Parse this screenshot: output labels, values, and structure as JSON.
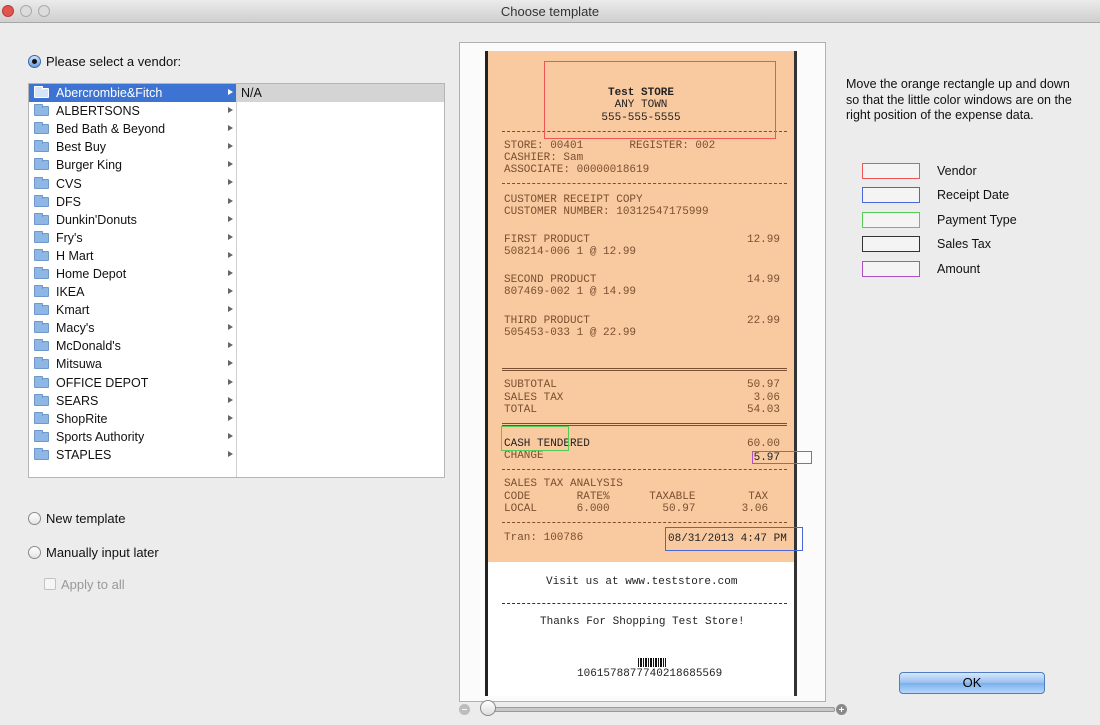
{
  "window": {
    "title": "Choose template"
  },
  "options": {
    "select_vendor": "Please select a vendor:",
    "new_template": "New template",
    "manual_input": "Manually input later",
    "apply_to_all": "Apply to all"
  },
  "vendors": {
    "items": [
      "Abercrombie&Fitch",
      "ALBERTSONS",
      "Bed Bath & Beyond",
      "Best Buy",
      "Burger King",
      "CVS",
      "DFS",
      "Dunkin'Donuts",
      "Fry's",
      "H Mart",
      "Home Depot",
      "IKEA",
      "Kmart",
      "Macy's",
      "McDonald's",
      "Mitsuwa",
      "OFFICE DEPOT",
      "SEARS",
      "ShopRite",
      "Sports Authority",
      "STAPLES"
    ],
    "selected": "Abercrombie&Fitch",
    "detail": "N/A"
  },
  "receipt": {
    "store_name": "Test STORE",
    "town": "ANY TOWN",
    "phone": "555-555-5555",
    "store_line": "STORE: 00401       REGISTER: 002",
    "cashier": "CASHIER: Sam",
    "associate": "ASSOCIATE: 00000018619",
    "copy": "CUSTOMER RECEIPT COPY",
    "customer_number": "CUSTOMER NUMBER: 10312547175999",
    "items": [
      {
        "name": "FIRST PRODUCT",
        "sku": "508214-006 1 @ 12.99",
        "price": "12.99"
      },
      {
        "name": "SECOND PRODUCT",
        "sku": "807469-002 1 @ 14.99",
        "price": "14.99"
      },
      {
        "name": "THIRD PRODUCT",
        "sku": "505453-033 1 @ 22.99",
        "price": "22.99"
      }
    ],
    "subtotal_label": "SUBTOTAL",
    "subtotal": "50.97",
    "tax_label": "SALES TAX",
    "tax": "3.06",
    "total_label": "TOTAL",
    "total": "54.03",
    "tender_label": "CASH TENDERED",
    "tender": "60.00",
    "change_label": "CHANGE",
    "change": "5.97",
    "analysis_title": "SALES TAX ANALYSIS",
    "analysis_header": "CODE       RATE%      TAXABLE        TAX",
    "analysis_row": "LOCAL      6.000        50.97       3.06",
    "tran": "Tran: 100786",
    "date": "08/31/2013 4:47 PM",
    "visit": "Visit us at www.teststore.com",
    "thanks": "Thanks For Shopping Test Store!",
    "barcode_number": "1061578877740218685569"
  },
  "instructions": "Move the orange rectangle up and down so that the little color windows are on the right position of the expense data.",
  "legend": [
    {
      "label": "Vendor",
      "color": "#ee5555"
    },
    {
      "label": "Receipt Date",
      "color": "#4a66d8"
    },
    {
      "label": "Payment Type",
      "color": "#55cc55"
    },
    {
      "label": "Sales Tax",
      "color": "#333333"
    },
    {
      "label": "Amount",
      "color": "#b050c8"
    }
  ],
  "zoom": {
    "level": 0
  },
  "buttons": {
    "ok": "OK"
  }
}
